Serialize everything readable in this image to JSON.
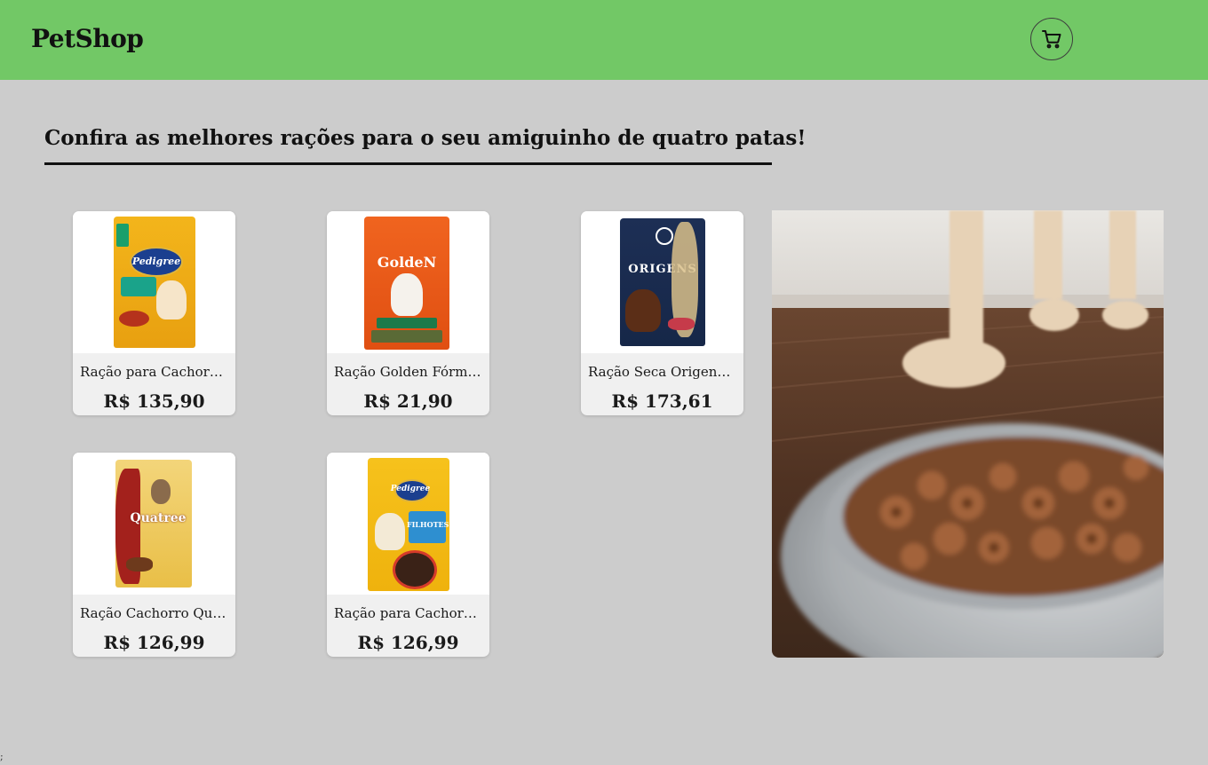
{
  "header": {
    "brand": "PetShop",
    "cart_icon": "shopping-cart-icon",
    "accent_color": "#72c866"
  },
  "main": {
    "headline": "Confira as melhores rações para o seu amiguinho de quatro patas!",
    "products": [
      {
        "name": "Ração para Cachorro Pedigree",
        "price": "R$ 135,90",
        "brand_label": "Pedigree"
      },
      {
        "name": "Ração Golden Fórmula",
        "price": "R$ 21,90",
        "brand_label": "GoldeN"
      },
      {
        "name": "Ração Seca Origens Classic",
        "price": "R$ 173,61",
        "brand_label": "ORIGENS"
      },
      {
        "name": "Ração Cachorro Quatree",
        "price": "R$ 126,99",
        "brand_label": "Quatree"
      },
      {
        "name": "Ração para Cachorro Pedigree Filhotes",
        "price": "R$ 126,99",
        "brand_label": "Pedigree",
        "sub_label": "FILHOTES"
      }
    ]
  },
  "footer": {
    "stray_text": ";"
  }
}
